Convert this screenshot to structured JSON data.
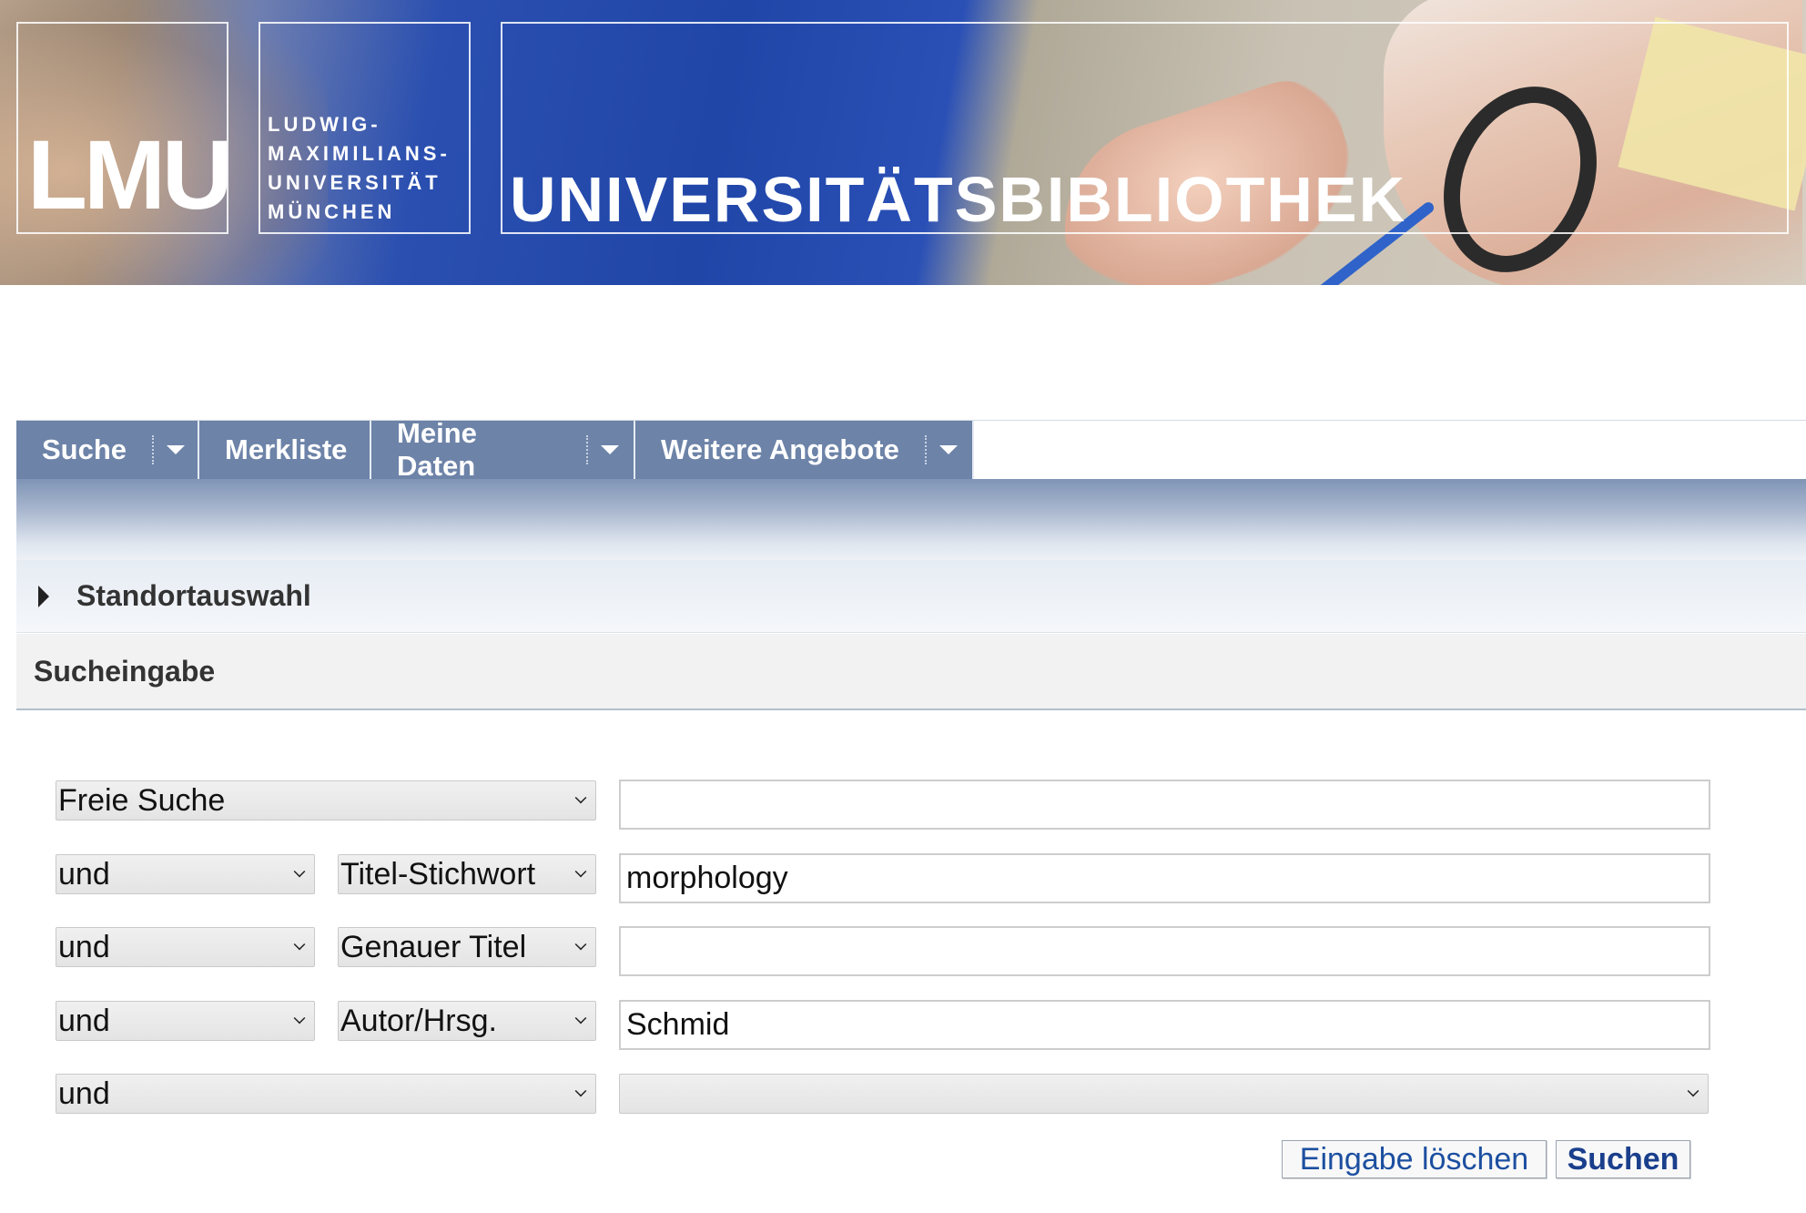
{
  "banner": {
    "logo": "LMU",
    "university_lines": [
      "LUDWIG-",
      "MAXIMILIANS-",
      "UNIVERSITÄT",
      "MÜNCHEN"
    ],
    "title": "UNIVERSITÄTSBIBLIOTHEK"
  },
  "nav": {
    "items": [
      {
        "label": "Suche",
        "has_menu": true
      },
      {
        "label": "Merkliste",
        "has_menu": false
      },
      {
        "label": "Meine Daten",
        "has_menu": true
      },
      {
        "label": "Weitere Angebote",
        "has_menu": true
      }
    ]
  },
  "standort": {
    "label": "Standortauswahl"
  },
  "search": {
    "header": "Sucheingabe",
    "rows": [
      {
        "field": "Freie Suche",
        "value": ""
      },
      {
        "operator": "und",
        "field": "Titel-Stichwort",
        "value": "morphology"
      },
      {
        "operator": "und",
        "field": "Genauer Titel",
        "value": ""
      },
      {
        "operator": "und",
        "field": "Autor/Hrsg.",
        "value": "Schmid"
      },
      {
        "operator": "und",
        "value_select": ""
      }
    ],
    "clear_label": "Eingabe löschen",
    "submit_label": "Suchen"
  },
  "colors": {
    "nav_bg": "#6d83a8",
    "button_text": "#1c4fa0"
  },
  "icons": {
    "menu_caret": "caret-down-icon",
    "expand": "triangle-right-icon",
    "select": "chevron-down-icon"
  }
}
